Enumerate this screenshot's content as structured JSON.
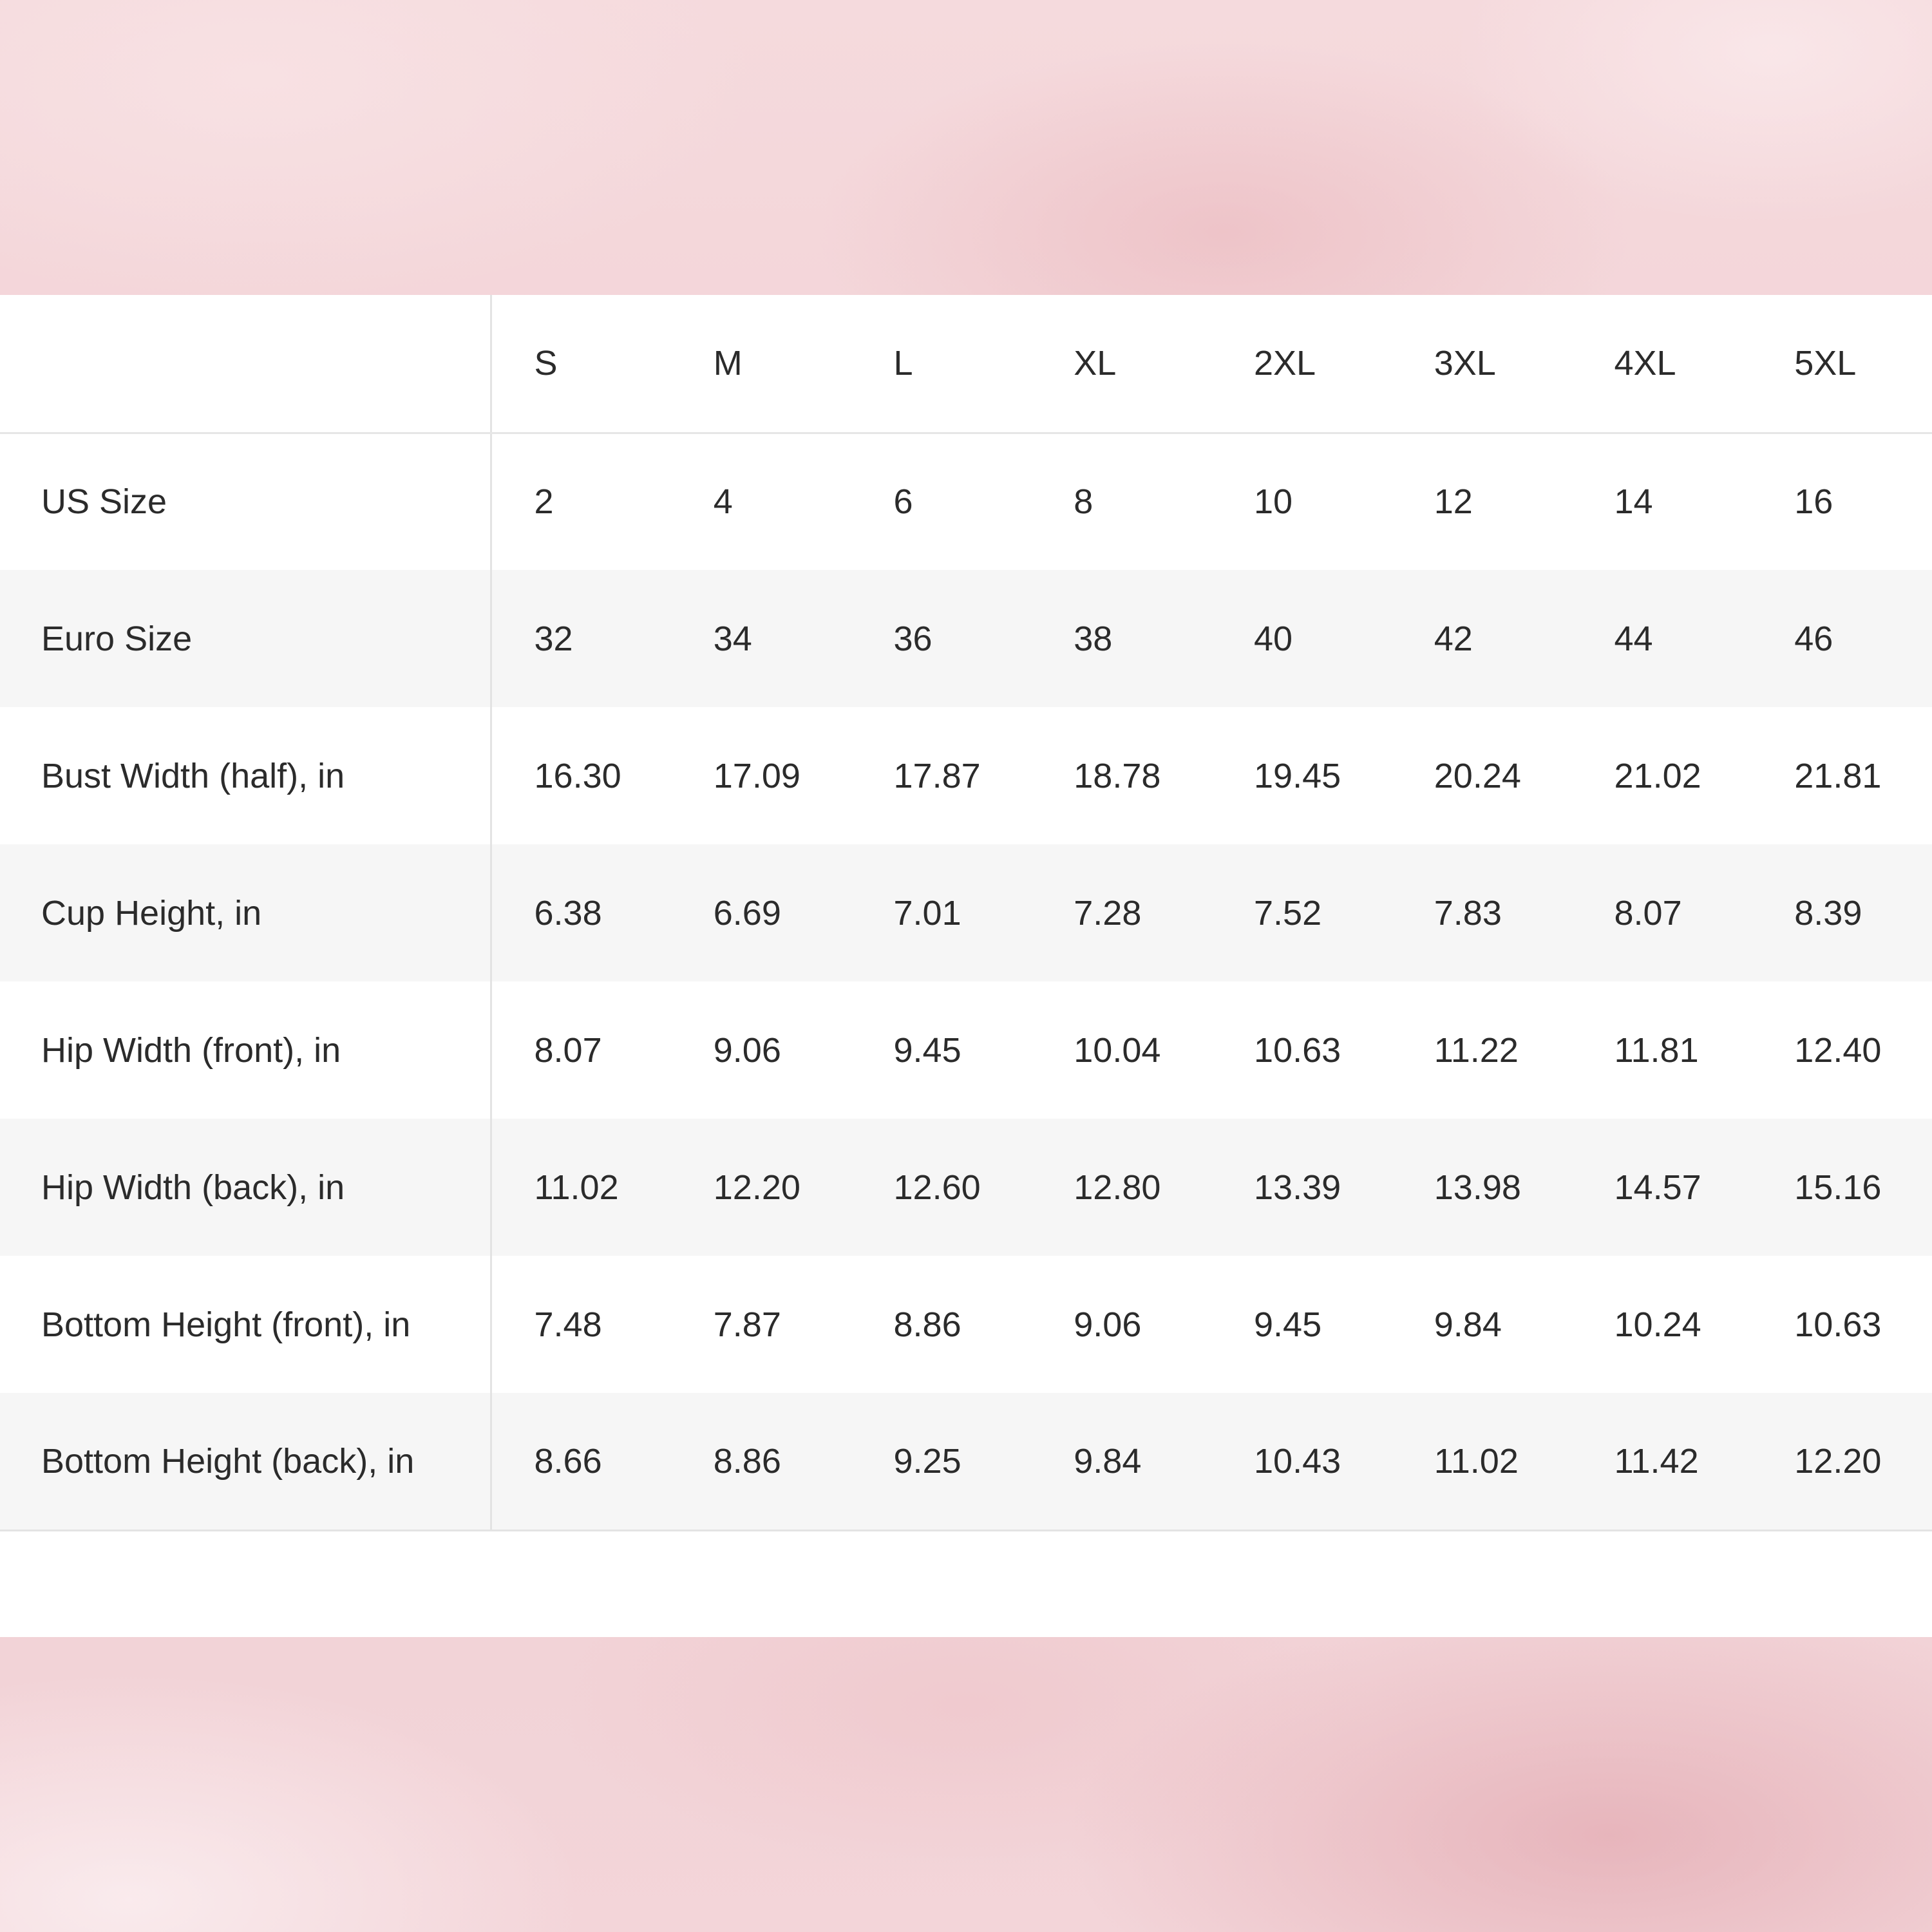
{
  "sizes": [
    "S",
    "M",
    "L",
    "XL",
    "2XL",
    "3XL",
    "4XL",
    "5XL"
  ],
  "rows": [
    {
      "label": "US Size",
      "values": [
        "2",
        "4",
        "6",
        "8",
        "10",
        "12",
        "14",
        "16"
      ]
    },
    {
      "label": "Euro Size",
      "values": [
        "32",
        "34",
        "36",
        "38",
        "40",
        "42",
        "44",
        "46"
      ]
    },
    {
      "label": "Bust Width (half), in",
      "values": [
        "16.30",
        "17.09",
        "17.87",
        "18.78",
        "19.45",
        "20.24",
        "21.02",
        "21.81"
      ]
    },
    {
      "label": "Cup Height, in",
      "values": [
        "6.38",
        "6.69",
        "7.01",
        "7.28",
        "7.52",
        "7.83",
        "8.07",
        "8.39"
      ]
    },
    {
      "label": "Hip Width (front), in",
      "values": [
        "8.07",
        "9.06",
        "9.45",
        "10.04",
        "10.63",
        "11.22",
        "11.81",
        "12.40"
      ]
    },
    {
      "label": "Hip Width (back), in",
      "values": [
        "11.02",
        "12.20",
        "12.60",
        "12.80",
        "13.39",
        "13.98",
        "14.57",
        "15.16"
      ]
    },
    {
      "label": "Bottom Height (front), in",
      "values": [
        "7.48",
        "7.87",
        "8.86",
        "9.06",
        "9.45",
        "9.84",
        "10.24",
        "10.63"
      ]
    },
    {
      "label": "Bottom Height (back), in",
      "values": [
        "8.66",
        "8.86",
        "9.25",
        "9.84",
        "10.43",
        "11.02",
        "11.42",
        "12.20"
      ]
    }
  ],
  "colors": {
    "background": "#f2d3d7",
    "panel": "#ffffff",
    "stripe": "#f6f6f6",
    "text": "#2b2b2b",
    "divider": "#e3e3e3"
  }
}
